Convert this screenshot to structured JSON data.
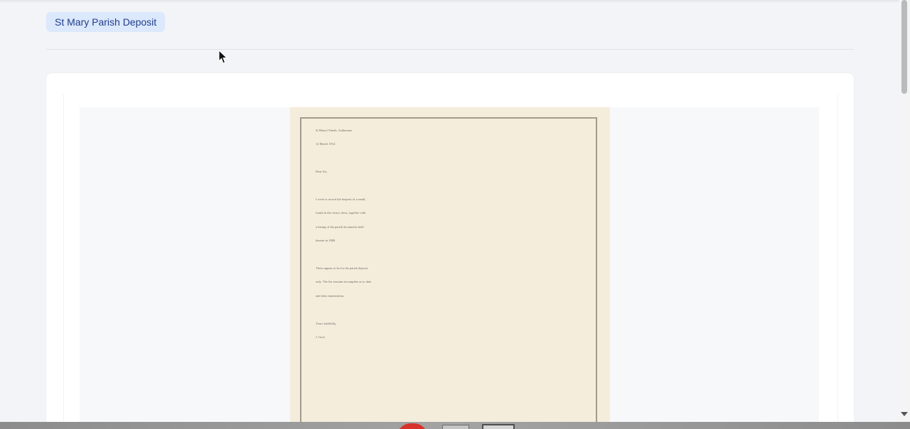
{
  "header": {
    "tag_label": "St Mary Parish Deposit"
  },
  "document": {
    "lines": [
      "St Mary's Parish, Ashbourne",
      "12 March 1912",
      "Dear Sir,",
      "I write to record the bequest of a small,",
      "found in the vestry chest, together with",
      "a listing of the parish documents held",
      "therein in 1880.",
      "These appear to be for the parish deposit",
      "only. The list remains incomplete as to date",
      "and item enumeration.",
      "Yours faithfully,",
      "J. Gore"
    ]
  },
  "colors": {
    "tag_background": "#dce8fb",
    "tag_text": "#1f3e8c",
    "page_background": "#f5eddc",
    "taskbar_red": "#d6322a"
  },
  "icons": {
    "cursor": "arrow-cursor-icon",
    "scroll_down": "scroll-down-arrow-icon"
  }
}
